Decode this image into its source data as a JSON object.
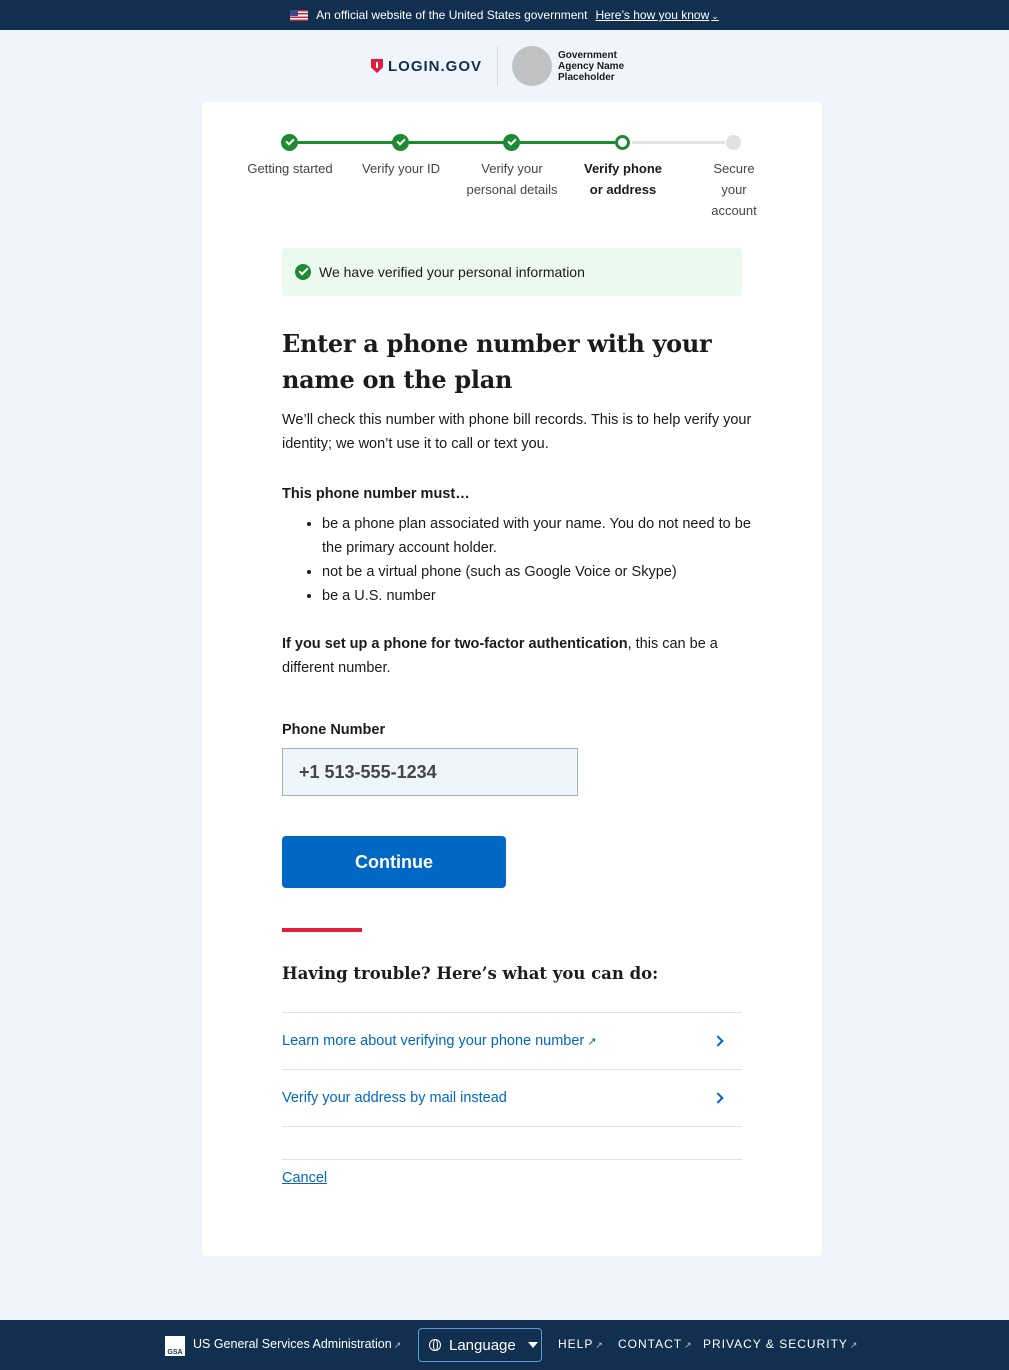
{
  "gov_banner": {
    "text": "An official website of the United States government",
    "link": "Here’s how you know"
  },
  "header": {
    "logo_text": "LOGIN.GOV",
    "agency_name": "Government Agency Name Placeholder"
  },
  "steps": [
    {
      "label": "Getting started",
      "state": "complete"
    },
    {
      "label": "Verify your ID",
      "state": "complete"
    },
    {
      "label": "Verify your personal details",
      "state": "complete"
    },
    {
      "label": "Verify phone or address",
      "state": "current"
    },
    {
      "label": "Secure your account",
      "state": "incomplete"
    }
  ],
  "alert": {
    "text": "We have verified your personal information"
  },
  "page_title": "Enter a phone number with your name on the plan",
  "intro": "We’ll check this number with phone bill records. This is to help verify your identity; we won’t use it to call or text you.",
  "requirements": {
    "title": "This phone number must…",
    "items": [
      "be a phone plan associated with your name. You do not need to be the primary account holder.",
      "not be a virtual phone (such as Google Voice or Skype)",
      "be a U.S. number"
    ]
  },
  "two_factor_note": {
    "bold": "If you set up a phone for two-factor authentication",
    "rest": ", this can be a different number."
  },
  "phone_field": {
    "label": "Phone Number",
    "value": "+1 513-555-1234"
  },
  "continue_label": "Continue",
  "trouble": {
    "title": "Having trouble? Here’s what you can do:",
    "links": [
      "Learn more about verifying your phone number",
      "Verify your address by mail instead"
    ]
  },
  "cancel_label": "Cancel",
  "footer": {
    "gsa_badge": "GSA",
    "agency": "US General Services Administration",
    "language": "Language",
    "help": "HELP",
    "contact": "CONTACT",
    "privacy": "PRIVACY & SECURITY"
  },
  "colors": {
    "banner_bg": "#112f4e",
    "page_bg": "#f0f5fb",
    "success_green": "#1f8a33",
    "primary_blue": "#0067c5",
    "accent_red": "#e21c3d"
  }
}
